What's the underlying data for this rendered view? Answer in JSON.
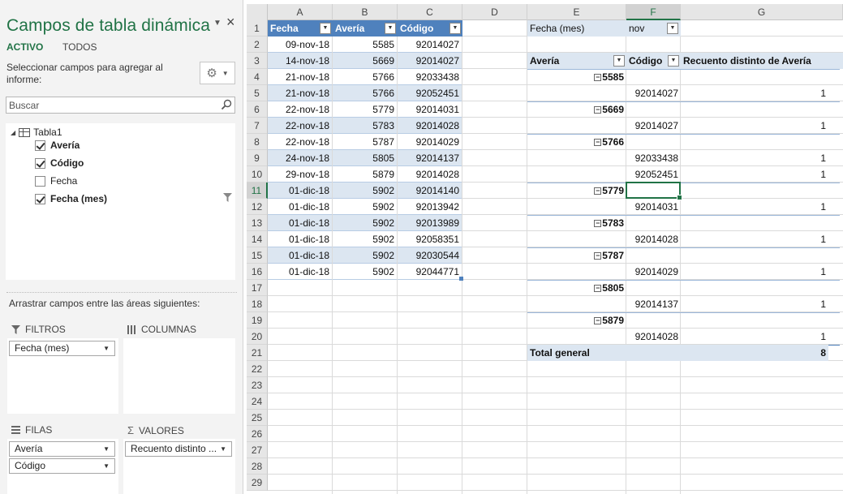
{
  "pane": {
    "title": "Campos de tabla dinámica",
    "close_glyph": "×",
    "dropdown_glyph": "▼",
    "tab_active": "ACTIVO",
    "tab_all": "TODOS",
    "instruction": "Seleccionar campos para agregar al informe:",
    "search_placeholder": "Buscar",
    "table_name": "Tabla1",
    "fields": [
      {
        "label": "Avería",
        "checked": true
      },
      {
        "label": "Código",
        "checked": true
      },
      {
        "label": "Fecha",
        "checked": false
      },
      {
        "label": "Fecha (mes)",
        "checked": true
      }
    ],
    "drag_label": "Arrastrar campos entre las áreas siguientes:",
    "areas": {
      "filters": {
        "title": "FILTROS",
        "items": [
          "Fecha (mes)"
        ]
      },
      "columns": {
        "title": "COLUMNAS",
        "items": []
      },
      "rows": {
        "title": "FILAS",
        "items": [
          "Avería",
          "Código"
        ]
      },
      "values": {
        "title": "VALORES",
        "items": [
          "Recuento distinto ..."
        ]
      }
    }
  },
  "sheet": {
    "columns": [
      "A",
      "B",
      "C",
      "D",
      "E",
      "F",
      "G"
    ],
    "selected_column": "F",
    "rows": [
      "1",
      "2",
      "3",
      "4",
      "5",
      "6",
      "7",
      "8",
      "9",
      "10",
      "11",
      "12",
      "13",
      "14",
      "15",
      "16",
      "17",
      "18",
      "19",
      "20",
      "21",
      "22",
      "23",
      "24",
      "25",
      "26",
      "27",
      "28",
      "29"
    ],
    "selected_row": "11",
    "table": {
      "headers": [
        "Fecha",
        "Avería",
        "Código"
      ],
      "rows": [
        [
          "09-nov-18",
          "5585",
          "92014027"
        ],
        [
          "14-nov-18",
          "5669",
          "92014027"
        ],
        [
          "21-nov-18",
          "5766",
          "92033438"
        ],
        [
          "21-nov-18",
          "5766",
          "92052451"
        ],
        [
          "22-nov-18",
          "5779",
          "92014031"
        ],
        [
          "22-nov-18",
          "5783",
          "92014028"
        ],
        [
          "22-nov-18",
          "5787",
          "92014029"
        ],
        [
          "24-nov-18",
          "5805",
          "92014137"
        ],
        [
          "29-nov-18",
          "5879",
          "92014028"
        ],
        [
          "01-dic-18",
          "5902",
          "92014140"
        ],
        [
          "01-dic-18",
          "5902",
          "92013942"
        ],
        [
          "01-dic-18",
          "5902",
          "92013989"
        ],
        [
          "01-dic-18",
          "5902",
          "92058351"
        ],
        [
          "01-dic-18",
          "5902",
          "92030544"
        ],
        [
          "01-dic-18",
          "5902",
          "92044771"
        ]
      ]
    },
    "pivot": {
      "filter_label": "Fecha (mes)",
      "filter_value": "nov",
      "headers": [
        "Avería",
        "Código",
        "Recuento distinto de Avería"
      ],
      "rows": [
        {
          "type": "group",
          "label": "5585"
        },
        {
          "type": "item",
          "code": "92014027",
          "count": "1"
        },
        {
          "type": "group",
          "label": "5669"
        },
        {
          "type": "item",
          "code": "92014027",
          "count": "1"
        },
        {
          "type": "group",
          "label": "5766"
        },
        {
          "type": "item",
          "code": "92033438",
          "count": "1"
        },
        {
          "type": "item",
          "code": "92052451",
          "count": "1"
        },
        {
          "type": "group",
          "label": "5779"
        },
        {
          "type": "item",
          "code": "92014031",
          "count": "1"
        },
        {
          "type": "group",
          "label": "5783"
        },
        {
          "type": "item",
          "code": "92014028",
          "count": "1"
        },
        {
          "type": "group",
          "label": "5787"
        },
        {
          "type": "item",
          "code": "92014029",
          "count": "1"
        },
        {
          "type": "group",
          "label": "5805"
        },
        {
          "type": "item",
          "code": "92014137",
          "count": "1"
        },
        {
          "type": "group",
          "label": "5879"
        },
        {
          "type": "item",
          "code": "92014028",
          "count": "1"
        }
      ],
      "total_label": "Total general",
      "total_value": "8"
    }
  },
  "colors": {
    "accent": "#217346",
    "table_header": "#4f81bd",
    "band": "#dce6f1"
  }
}
